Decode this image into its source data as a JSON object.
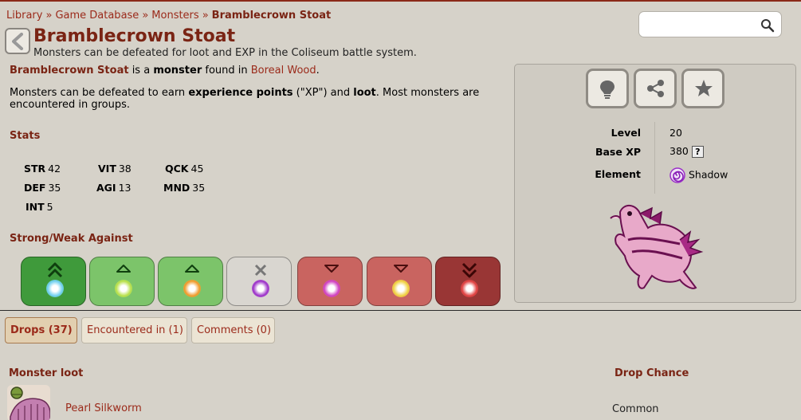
{
  "breadcrumb": [
    "Library",
    "Game Database",
    "Monsters",
    "Bramblecrown Stoat"
  ],
  "breadcrumb_separator": "»",
  "search": {
    "value": "",
    "placeholder": ""
  },
  "page": {
    "title": "Bramblecrown Stoat",
    "subtitle": "Monsters can be defeated for loot and EXP in the Coliseum battle system."
  },
  "intro": {
    "name": "Bramblecrown Stoat",
    "text1": " is a ",
    "monster_word": "monster",
    "text2": " found in ",
    "location": "Boreal Wood",
    "text3": "."
  },
  "description": {
    "t1": "Monsters can be defeated to earn ",
    "b1": "experience points",
    "t2": " (\"XP\") and ",
    "b2": "loot",
    "t3": ". Most monsters are encountered in groups."
  },
  "stats": {
    "heading": "Stats",
    "items": [
      {
        "label": "STR",
        "value": "42"
      },
      {
        "label": "VIT",
        "value": "38"
      },
      {
        "label": "QCK",
        "value": "45"
      },
      {
        "label": "DEF",
        "value": "35"
      },
      {
        "label": "AGI",
        "value": "13"
      },
      {
        "label": "MND",
        "value": "35"
      },
      {
        "label": "INT",
        "value": "5"
      }
    ]
  },
  "strong_weak": {
    "heading": "Strong/Weak Against",
    "tiles": [
      {
        "element_icon": "ice-icon",
        "effect": "double-up",
        "bg": "#3f9a3b",
        "elem_color": "#6fd0f0"
      },
      {
        "element_icon": "wind-icon",
        "effect": "up",
        "bg": "#7cc46a",
        "elem_color": "#b8e04a"
      },
      {
        "element_icon": "fire-icon",
        "effect": "up",
        "bg": "#7cc46a",
        "elem_color": "#f09a2a"
      },
      {
        "element_icon": "shadow-icon",
        "effect": "neutral",
        "bg": "#d9d6d0",
        "elem_color": "#9b30c8"
      },
      {
        "element_icon": "arcane-icon",
        "effect": "down",
        "bg": "#c96460",
        "elem_color": "#d040c0"
      },
      {
        "element_icon": "light-icon",
        "effect": "down",
        "bg": "#c96460",
        "elem_color": "#f0d040"
      },
      {
        "element_icon": "plague-icon",
        "effect": "double-down",
        "bg": "#993635",
        "elem_color": "#e04040"
      }
    ]
  },
  "panel": {
    "buttons": [
      {
        "icon": "lightbulb-icon"
      },
      {
        "icon": "share-icon"
      },
      {
        "icon": "star-icon"
      }
    ],
    "level_label": "Level",
    "level_value": "20",
    "xp_label": "Base XP",
    "xp_value": "380",
    "help_label": "?",
    "element_label": "Element",
    "element_value": "Shadow"
  },
  "tabs": [
    {
      "label": "Drops (37)",
      "active": true
    },
    {
      "label": "Encountered in (1)",
      "active": false
    },
    {
      "label": "Comments (0)",
      "active": false
    }
  ],
  "drops": {
    "col_loot": "Monster loot",
    "col_chance": "Drop Chance",
    "rows": [
      {
        "name": "Pearl Silkworm",
        "chance": "Common",
        "icon": "silkworm-icon"
      }
    ]
  },
  "colors": {
    "accent": "#7a2414",
    "link": "#9b2a1a",
    "background": "#d6d2c9"
  }
}
